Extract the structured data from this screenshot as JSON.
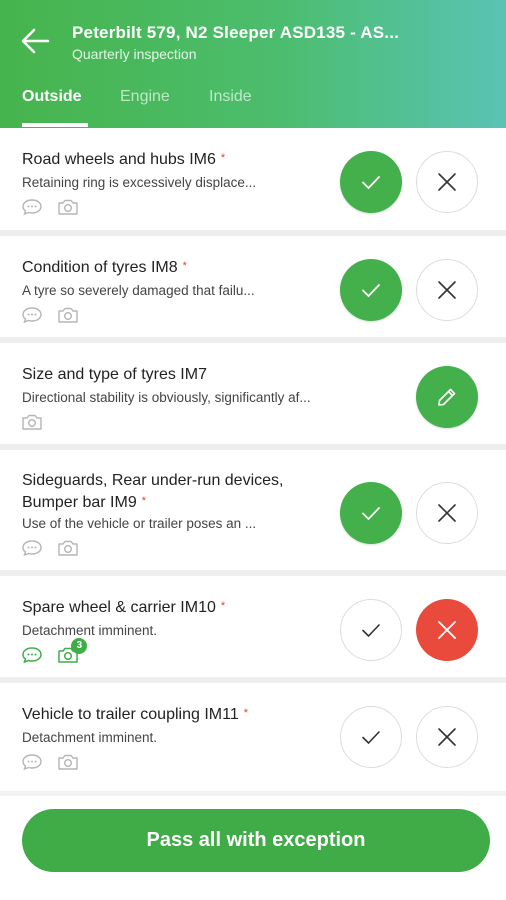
{
  "header": {
    "title": "Peterbilt 579, N2 Sleeper ASD135 - AS...",
    "subtitle": "Quarterly inspection",
    "tabs": [
      {
        "label": "Outside",
        "active": true
      },
      {
        "label": "Engine",
        "active": false
      },
      {
        "label": "Inside",
        "active": false
      }
    ]
  },
  "colors": {
    "accent_green": "#44b04b",
    "fail_red": "#ea4a3c",
    "header_gradient_start": "#46b44c",
    "header_gradient_end": "#5ac3b4"
  },
  "items": [
    {
      "title": "Road wheels and hubs IM6",
      "required": "*",
      "description": "Retaining ring is excessively displace...",
      "state": "pass",
      "icons": [
        "comment-icon",
        "camera-icon"
      ]
    },
    {
      "title": "Condition of tyres IM8",
      "required": "*",
      "description": "A tyre so severely damaged that failu...",
      "state": "pass",
      "icons": [
        "comment-icon",
        "camera-icon"
      ]
    },
    {
      "title": "Size and type of tyres IM7",
      "required": "",
      "description": "Directional stability is obviously, significantly af...",
      "state": "edit",
      "icons": [
        "camera-icon"
      ]
    },
    {
      "title": "Sideguards, Rear under-run devices, Bumper bar IM9",
      "required": "*",
      "description": "Use of the vehicle or trailer poses an ...",
      "state": "pass",
      "icons": [
        "comment-icon",
        "camera-icon"
      ]
    },
    {
      "title": "Spare wheel & carrier IM10",
      "required": "*",
      "description": "Detachment imminent.",
      "state": "fail",
      "icons": [
        "comment-icon",
        "camera-icon"
      ],
      "photo_count": "3"
    },
    {
      "title": "Vehicle to trailer coupling IM11",
      "required": "*",
      "description": "Detachment imminent.",
      "state": "none",
      "icons": [
        "comment-icon",
        "camera-icon"
      ]
    }
  ],
  "footer": {
    "pass_all_label": "Pass all with exception"
  }
}
